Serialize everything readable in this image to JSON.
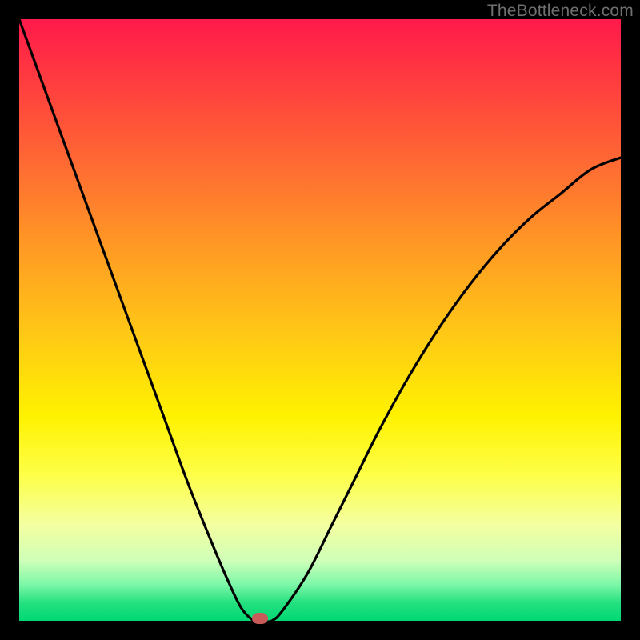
{
  "watermark": "TheBottleneck.com",
  "colors": {
    "background": "#000000",
    "curve_stroke": "#000000",
    "marker_fill": "#c85a5a",
    "gradient_stops": [
      "#ff1a4b",
      "#ff3b3f",
      "#ff6a33",
      "#ff9a24",
      "#ffc716",
      "#fff200",
      "#fdff4a",
      "#f4ffa0",
      "#cfffb8",
      "#7cf7a8",
      "#25e07f",
      "#00d874"
    ]
  },
  "chart_data": {
    "type": "line",
    "title": "",
    "xlabel": "",
    "ylabel": "",
    "xlim": [
      0,
      100
    ],
    "ylim": [
      0,
      100
    ],
    "series": [
      {
        "name": "bottleneck-curve",
        "x": [
          0,
          4,
          8,
          12,
          16,
          20,
          24,
          28,
          32,
          35,
          37,
          39,
          40,
          42,
          44,
          48,
          52,
          56,
          60,
          65,
          70,
          75,
          80,
          85,
          90,
          95,
          100
        ],
        "values": [
          100,
          89,
          78,
          67,
          56,
          45,
          34,
          23,
          13,
          6,
          2,
          0,
          0,
          0,
          2,
          8,
          16,
          24,
          32,
          41,
          49,
          56,
          62,
          67,
          71,
          75,
          77
        ]
      }
    ],
    "marker": {
      "x": 40,
      "y": 0,
      "name": "optimal-point"
    }
  }
}
